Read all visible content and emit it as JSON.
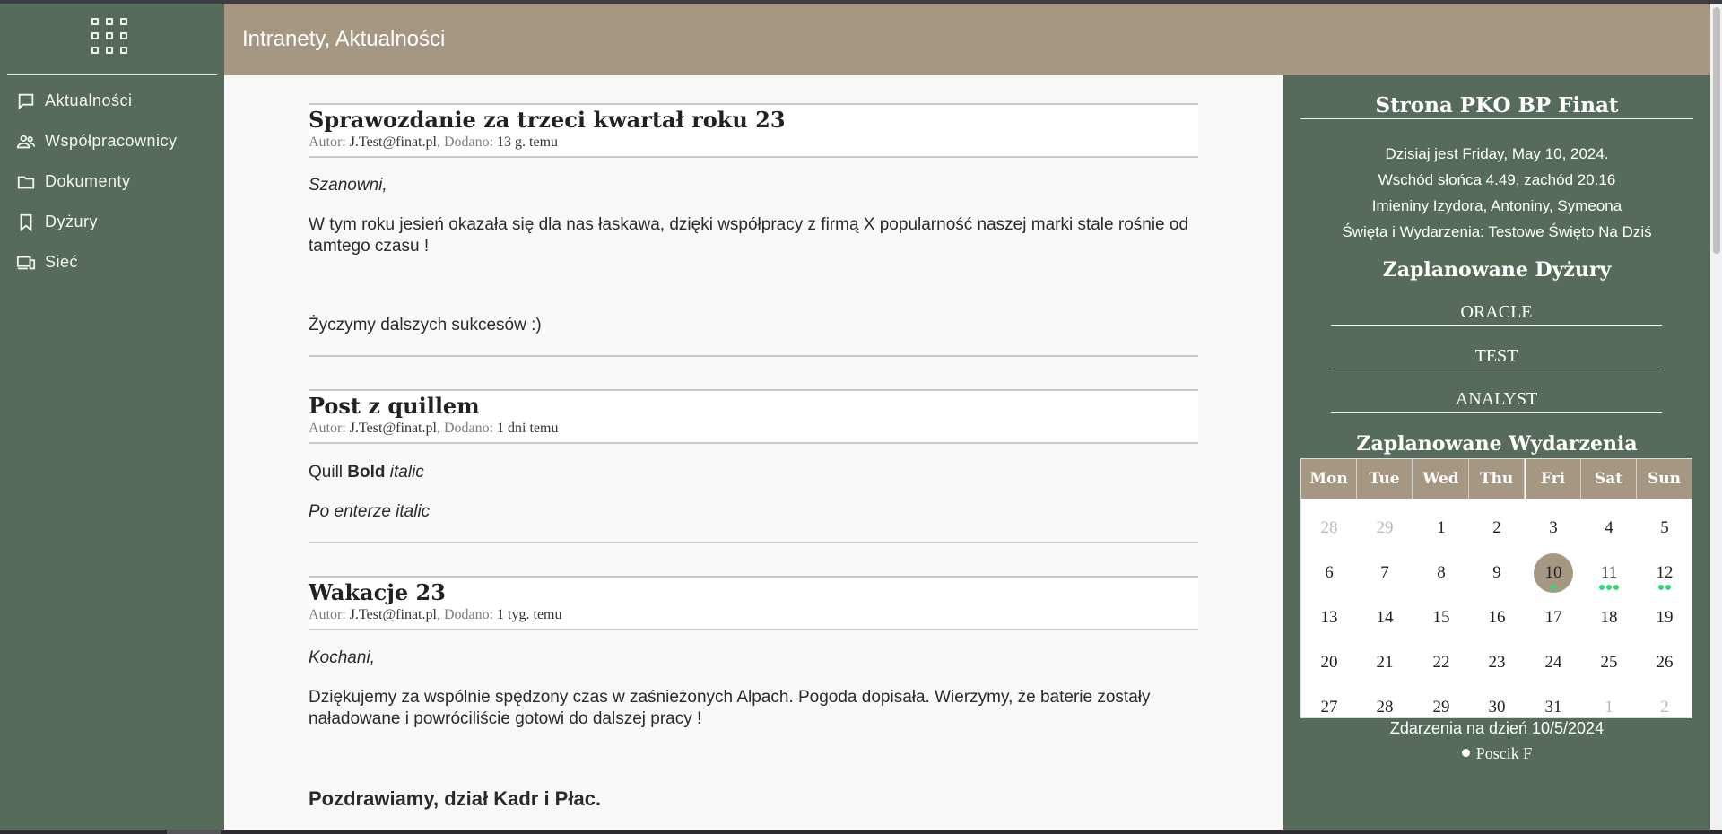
{
  "header": {
    "title": "Intranety, Aktualności"
  },
  "sidebar": {
    "logo_icon": "apps-grid-icon",
    "items": [
      {
        "label": "Aktualności",
        "icon": "chat-bubble-icon"
      },
      {
        "label": "Współpracownicy",
        "icon": "people-icon"
      },
      {
        "label": "Dokumenty",
        "icon": "folder-icon"
      },
      {
        "label": "Dyżury",
        "icon": "bookmark-icon"
      },
      {
        "label": "Sieć",
        "icon": "devices-icon"
      }
    ]
  },
  "posts": [
    {
      "title": "Sprawozdanie za trzeci kwartał roku 23",
      "author_label": "Autor:",
      "author": "J.Test@finat.pl",
      "added_label": "Dodano:",
      "added": "13 g. temu",
      "greeting": "Szanowni,",
      "paragraph": "W tym roku jesień okazała się dla nas łaskawa, dzięki współpracy z firmą X popularność naszej marki stale rośnie od tamtego czasu !",
      "closing": "Życzymy dalszych sukcesów :)"
    },
    {
      "title": "Post z quillem",
      "author_label": "Autor:",
      "author": "J.Test@finat.pl",
      "added_label": "Dodano:",
      "added": "1 dni temu",
      "line1_plain": "Quill",
      "line1_bold": "Bold",
      "line1_italic": "italic",
      "line2": "Po enterze italic"
    },
    {
      "title": "Wakacje 23",
      "author_label": "Autor:",
      "author": "J.Test@finat.pl",
      "added_label": "Dodano:",
      "added": "1 tyg. temu",
      "greeting": "Kochani,",
      "paragraph": "Dziękujemy za wspólnie spędzony czas w zaśnieżonych Alpach. Pogoda dopisała. Wierzymy, że baterie zostały naładowane i powróciliście gotowi do dalszej pracy !",
      "signature": "Pozdrawiamy, dział Kadr i Płac."
    }
  ],
  "right": {
    "site_title": "Strona PKO BP Finat",
    "today": "Dzisiaj jest Friday, May 10, 2024.",
    "sun": "Wschód słońca 4.49, zachód 20.16",
    "namedays": "Imieniny Izydora, Antoniny, Symeona",
    "holidays": "Święta i Wydarzenia: Testowe Święto Na Dziś",
    "duties_title": "Zaplanowane Dyżury",
    "duties": [
      "ORACLE",
      "TEST",
      "ANALYST"
    ],
    "events_title": "Zaplanowane Wydarzenia",
    "events_date": "Zdarzenia na dzień 10/5/2024",
    "events": [
      "Poscik F"
    ]
  },
  "calendar": {
    "weekdays": [
      "Mon",
      "Tue",
      "Wed",
      "Thu",
      "Fri",
      "Sat",
      "Sun"
    ],
    "today": "10",
    "today_color": "#a69782",
    "dot_color": "#2ddc79",
    "weeks": [
      [
        {
          "d": "28",
          "muted": true
        },
        {
          "d": "29",
          "muted": true
        },
        {
          "d": "1"
        },
        {
          "d": "2"
        },
        {
          "d": "3"
        },
        {
          "d": "4"
        },
        {
          "d": "5"
        }
      ],
      [
        {
          "d": "6"
        },
        {
          "d": "7"
        },
        {
          "d": "8"
        },
        {
          "d": "9"
        },
        {
          "d": "10",
          "today": true,
          "dots": 1
        },
        {
          "d": "11",
          "dots": 3
        },
        {
          "d": "12",
          "dots": 2
        }
      ],
      [
        {
          "d": "13"
        },
        {
          "d": "14"
        },
        {
          "d": "15"
        },
        {
          "d": "16"
        },
        {
          "d": "17"
        },
        {
          "d": "18"
        },
        {
          "d": "19"
        }
      ],
      [
        {
          "d": "20"
        },
        {
          "d": "21"
        },
        {
          "d": "22"
        },
        {
          "d": "23"
        },
        {
          "d": "24"
        },
        {
          "d": "25"
        },
        {
          "d": "26"
        }
      ],
      [
        {
          "d": "27"
        },
        {
          "d": "28"
        },
        {
          "d": "29"
        },
        {
          "d": "30"
        },
        {
          "d": "31"
        },
        {
          "d": "1",
          "muted": true
        },
        {
          "d": "2",
          "muted": true
        }
      ]
    ]
  },
  "colors": {
    "sidebar": "#566b5c",
    "header": "#a69782",
    "accent_dot": "#2ddc79"
  }
}
